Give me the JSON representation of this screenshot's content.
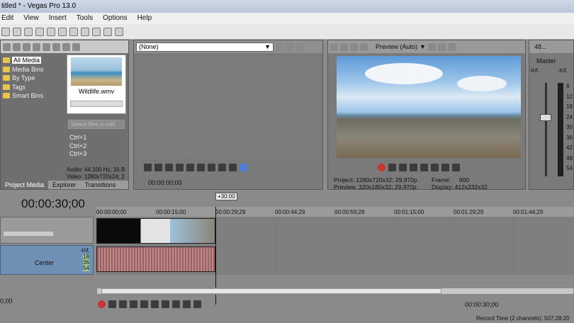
{
  "window": {
    "title": "titled * - Vegas Pro 13.0"
  },
  "menu": [
    "Edit",
    "View",
    "Insert",
    "Tools",
    "Options",
    "Help"
  ],
  "explorer": {
    "tree": [
      "All Media",
      "Media Bins",
      "By Type",
      "Tags",
      "Smart Bins"
    ],
    "clip_name": "Wildlife.wmv",
    "select_files_placeholder": "Select files to edit",
    "shortcuts": [
      "Ctrl+1",
      "Ctrl+2",
      "Ctrl+3"
    ],
    "audio_info": "Audio: 44.100 Hz, 16 B",
    "video_info": "Video: 1280x720x24; 2",
    "tabs": [
      "Project Media",
      "Explorer",
      "Transitions"
    ]
  },
  "trimmer": {
    "preset": "(None)",
    "timecode": "00:00:00;00"
  },
  "preview": {
    "mode": "Preview (Auto)",
    "project_label": "Project:",
    "project_value": "1280x720x32; 29,970p",
    "preview_label": "Preview:",
    "preview_value": "320x180x32; 29,970p",
    "frame_label": "Frame:",
    "frame_value": "900",
    "display_label": "Display:",
    "display_value": "412x232x32"
  },
  "master": {
    "title": "48...",
    "label": "Master",
    "inf_left": "-Inf.",
    "inf_right": "-Inf.",
    "scale": [
      "6",
      "12",
      "18",
      "24",
      "30",
      "36",
      "42",
      "48",
      "54"
    ]
  },
  "timeline": {
    "timecode": "00:00:30;00",
    "marker": "+30:00",
    "ruler": [
      "00:00:00;00",
      "00:00:15;00",
      "00:00:29;29",
      "00:00:44;29",
      "00:00:59;28",
      "00:01:15;00",
      "00:01:29;29",
      "00:01:44;29"
    ],
    "audio_pan": "Center",
    "audio_inf": "-Inf.",
    "audio_scale": [
      "18",
      "36",
      "54"
    ],
    "rate": "0,00",
    "bottom_time": "00:00:30;00",
    "record_time": "Record Time (2 channels): 507:28:20"
  }
}
